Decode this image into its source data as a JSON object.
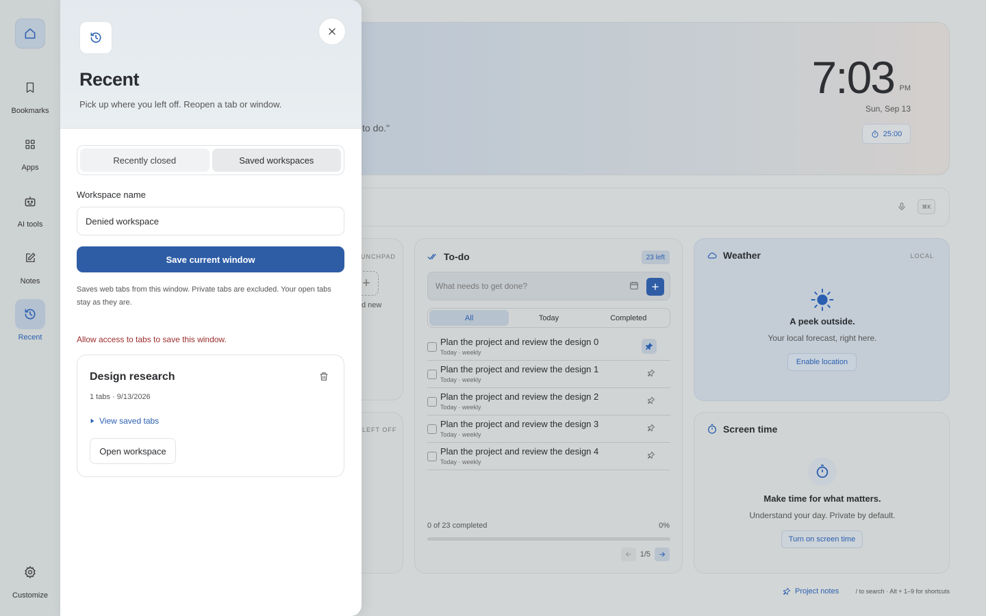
{
  "sidebar": {
    "items": [
      {
        "label": ""
      },
      {
        "label": "Bookmarks"
      },
      {
        "label": "Apps"
      },
      {
        "label": "AI tools"
      },
      {
        "label": "Notes"
      },
      {
        "label": "Recent"
      }
    ],
    "customize_label": "Customize"
  },
  "hero": {
    "quote_fragment": "to do.\"",
    "time": "7:03",
    "ampm": "PM",
    "date": "Sun, Sep 13",
    "timer": "25:00"
  },
  "search": {
    "shortcut": "⌘K"
  },
  "launchpad": {
    "label": "UNCHPAD",
    "add_new": "d new"
  },
  "left_off": {
    "label": "LEFT OFF"
  },
  "todo": {
    "title": "To-do",
    "left_badge": "23 left",
    "input_placeholder": "What needs to get done?",
    "filters": [
      "All",
      "Today",
      "Completed"
    ],
    "items": [
      {
        "text": "Plan the project and review the design 0",
        "sub": "Today · weekly",
        "pinned": true
      },
      {
        "text": "Plan the project and review the design 1",
        "sub": "Today · weekly",
        "pinned": false
      },
      {
        "text": "Plan the project and review the design 2",
        "sub": "Today · weekly",
        "pinned": false
      },
      {
        "text": "Plan the project and review the design 3",
        "sub": "Today · weekly",
        "pinned": false
      },
      {
        "text": "Plan the project and review the design 4",
        "sub": "Today · weekly",
        "pinned": false
      }
    ],
    "progress_text": "0 of 23 completed",
    "progress_pct": "0%",
    "progress_value": 0,
    "page": "1/5"
  },
  "weather": {
    "title": "Weather",
    "badge": "LOCAL",
    "headline": "A peek outside.",
    "sub": "Your local forecast, right here.",
    "button": "Enable location"
  },
  "screen_time": {
    "title": "Screen time",
    "headline": "Make time for what matters.",
    "sub": "Understand your day. Private by default.",
    "button": "Turn on screen time"
  },
  "footer": {
    "link": "Project notes",
    "hint": "/ to search · Alt + 1–9 for shortcuts"
  },
  "panel": {
    "title": "Recent",
    "subtitle": "Pick up where you left off. Reopen a tab or window.",
    "tabs": [
      "Recently closed",
      "Saved workspaces"
    ],
    "active_tab": "Saved workspaces",
    "workspace_label": "Workspace name",
    "workspace_value": "Denied workspace",
    "save_button": "Save current window",
    "help_text": "Saves web tabs from this window. Private tabs are excluded. Your open tabs stay as they are.",
    "error_text": "Allow access to tabs to save this window.",
    "workspace": {
      "name": "Design research",
      "meta": "1 tabs · 9/13/2026",
      "view_link": "View saved tabs",
      "open_button": "Open workspace"
    }
  },
  "colors": {
    "accent": "#2e5da6",
    "error": "#9b2c2c",
    "link": "#2a5fb0"
  }
}
